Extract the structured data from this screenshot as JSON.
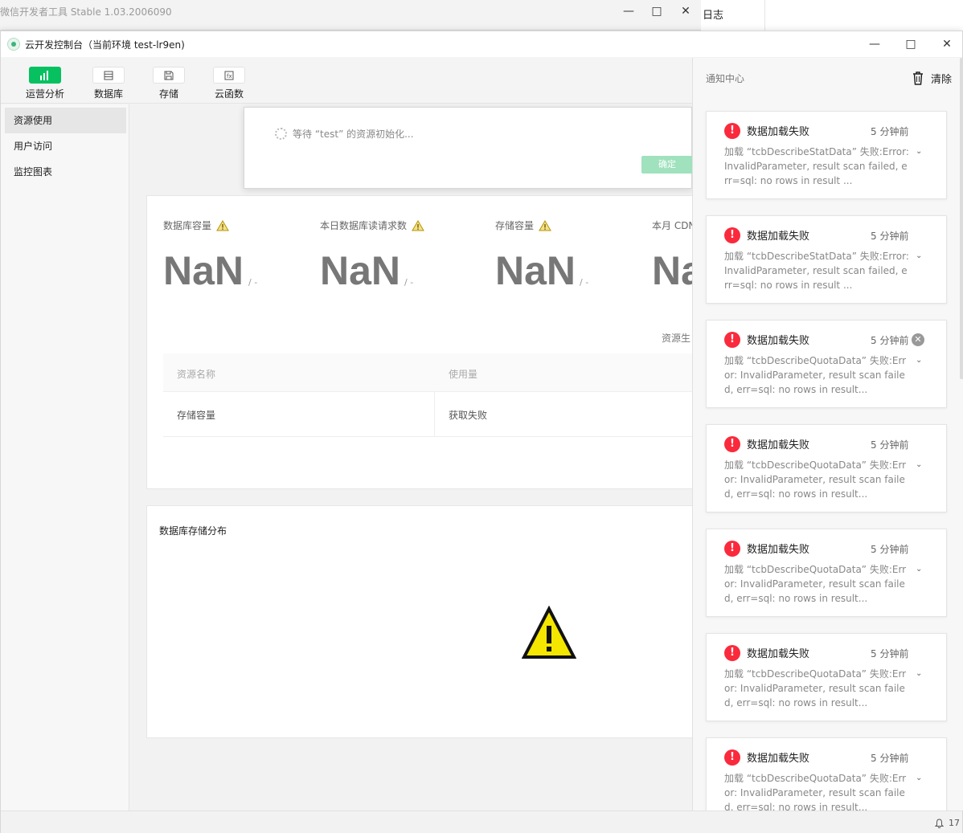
{
  "bg_window": {
    "title": "微信开发者工具 Stable 1.03.2006090",
    "right_label": "日志"
  },
  "window": {
    "title": "云开发控制台（当前环境 test-lr9en)"
  },
  "toolbar": {
    "items": [
      {
        "label": "运营分析",
        "icon": "chart-icon",
        "active": true
      },
      {
        "label": "数据库",
        "icon": "database-icon"
      },
      {
        "label": "存储",
        "icon": "storage-icon"
      },
      {
        "label": "云函数",
        "icon": "function-icon"
      }
    ]
  },
  "sidebar": {
    "items": [
      {
        "label": "资源使用",
        "active": true
      },
      {
        "label": "用户访问"
      },
      {
        "label": "监控图表"
      }
    ]
  },
  "dialog": {
    "message": "等待 “test” 的资源初始化...",
    "confirm": "确定"
  },
  "stats": [
    {
      "label": "数据库容量",
      "value": "NaN",
      "suffix": "/ -"
    },
    {
      "label": "本日数据库读请求数",
      "value": "NaN",
      "suffix": "/ -"
    },
    {
      "label": "存储容量",
      "value": "NaN",
      "suffix": "/ -"
    },
    {
      "label": "本月 CDN",
      "value": "Na"
    }
  ],
  "resource_label": "资源生",
  "table": {
    "headers": [
      "资源名称",
      "使用量"
    ],
    "rows": [
      [
        "存储容量",
        "获取失败"
      ]
    ]
  },
  "db_dist": {
    "title": "数据库存储分布"
  },
  "notifications": {
    "header": "通知中心",
    "clear": "清除",
    "items": [
      {
        "title": "数据加载失败",
        "time": "5 分钟前",
        "body": "加载 “tcbDescribeStatData” 失败:Error: InvalidParameter, result scan failed, err=sql: no rows in result ..."
      },
      {
        "title": "数据加载失败",
        "time": "5 分钟前",
        "body": "加载 “tcbDescribeStatData” 失败:Error: InvalidParameter, result scan failed, err=sql: no rows in result ..."
      },
      {
        "title": "数据加载失败",
        "time": "5 分钟前",
        "body": "加载 “tcbDescribeQuotaData” 失败:Error: InvalidParameter, result scan failed, err=sql: no rows in result...",
        "closable": true
      },
      {
        "title": "数据加载失败",
        "time": "5 分钟前",
        "body": "加载 “tcbDescribeQuotaData” 失败:Error: InvalidParameter, result scan failed, err=sql: no rows in result..."
      },
      {
        "title": "数据加载失败",
        "time": "5 分钟前",
        "body": "加载 “tcbDescribeQuotaData” 失败:Error: InvalidParameter, result scan failed, err=sql: no rows in result..."
      },
      {
        "title": "数据加载失败",
        "time": "5 分钟前",
        "body": "加载 “tcbDescribeQuotaData” 失败:Error: InvalidParameter, result scan failed, err=sql: no rows in result..."
      },
      {
        "title": "数据加载失败",
        "time": "5 分钟前",
        "body": "加载 “tcbDescribeQuotaData” 失败:Error: InvalidParameter, result scan failed, err=sql: no rows in result..."
      }
    ]
  },
  "statusbar": {
    "notification_count": "17"
  },
  "colors": {
    "accent": "#07c160",
    "error": "#fa2a3c",
    "warning": "#f5d90a"
  }
}
